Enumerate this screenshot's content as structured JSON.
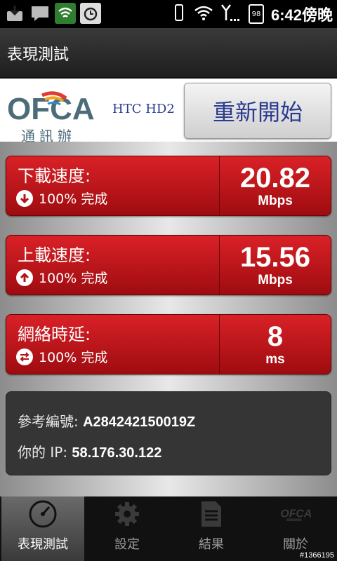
{
  "status_bar": {
    "time": "6:42傍晚",
    "battery": "98",
    "left_icons": [
      "download-icon",
      "message-icon",
      "shield-icon",
      "alarm-icon"
    ],
    "right_icons": [
      "vibrate-icon",
      "wifi-icon",
      "signal-icon",
      "battery-icon"
    ]
  },
  "title_bar": {
    "title": "表現測試"
  },
  "header": {
    "logo_text": "OFCA",
    "logo_subtitle": "通訊辦",
    "device": "HTC HD2",
    "restart_label": "重新開始"
  },
  "download": {
    "label": "下載速度:",
    "progress": "100% 完成",
    "value": "20.82",
    "unit": "Mbps"
  },
  "upload": {
    "label": "上載速度:",
    "progress": "100% 完成",
    "value": "15.56",
    "unit": "Mbps"
  },
  "latency": {
    "label": "網絡時延:",
    "progress": "100% 完成",
    "value": "8",
    "unit": "ms"
  },
  "info": {
    "ref_label": "參考編號:",
    "ref_value": "A284242150019Z",
    "ip_label": "你的 IP:",
    "ip_value": "58.176.30.122"
  },
  "tabs": [
    {
      "label": "表現測試",
      "icon": "speedometer-icon"
    },
    {
      "label": "設定",
      "icon": "gear-icon"
    },
    {
      "label": "結果",
      "icon": "document-icon"
    },
    {
      "label": "關於",
      "icon": "ofca-logo-icon"
    }
  ],
  "watermark": "#1366195",
  "colors": {
    "card_red": "#c4161c",
    "brand_blue": "#2b3b8f",
    "background": "#000000"
  }
}
